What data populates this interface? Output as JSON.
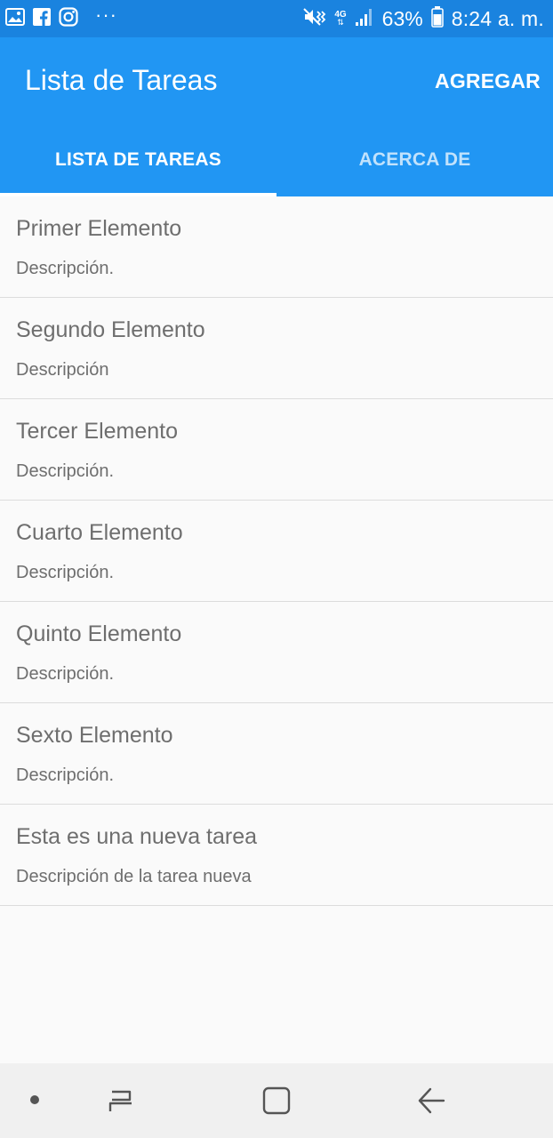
{
  "status_bar": {
    "dots": "···",
    "battery_percent": "63%",
    "time": "8:24 a. m.",
    "network": "4G",
    "icons": [
      "gallery-icon",
      "facebook-icon",
      "instagram-icon",
      "vibrate-mute-icon",
      "signal-icon",
      "battery-icon"
    ]
  },
  "app_bar": {
    "title": "Lista de Tareas",
    "add_label": "AGREGAR"
  },
  "tabs": [
    {
      "label": "LISTA DE TAREAS",
      "active": true
    },
    {
      "label": "ACERCA DE",
      "active": false
    }
  ],
  "tasks": [
    {
      "title": "Primer Elemento",
      "description": "Descripción."
    },
    {
      "title": "Segundo Elemento",
      "description": "Descripción"
    },
    {
      "title": "Tercer Elemento",
      "description": "Descripción."
    },
    {
      "title": "Cuarto Elemento",
      "description": "Descripción."
    },
    {
      "title": "Quinto Elemento",
      "description": "Descripción."
    },
    {
      "title": "Sexto Elemento",
      "description": "Descripción."
    },
    {
      "title": "Esta es una nueva tarea",
      "description": "Descripción de la tarea nueva"
    }
  ],
  "nav_bar": {
    "icons": [
      "recent-apps-icon",
      "home-icon",
      "back-icon"
    ]
  },
  "colors": {
    "status_bar": "#1a83df",
    "primary": "#2196f3",
    "background": "#fafafa",
    "text_secondary": "#6e6e6e"
  }
}
